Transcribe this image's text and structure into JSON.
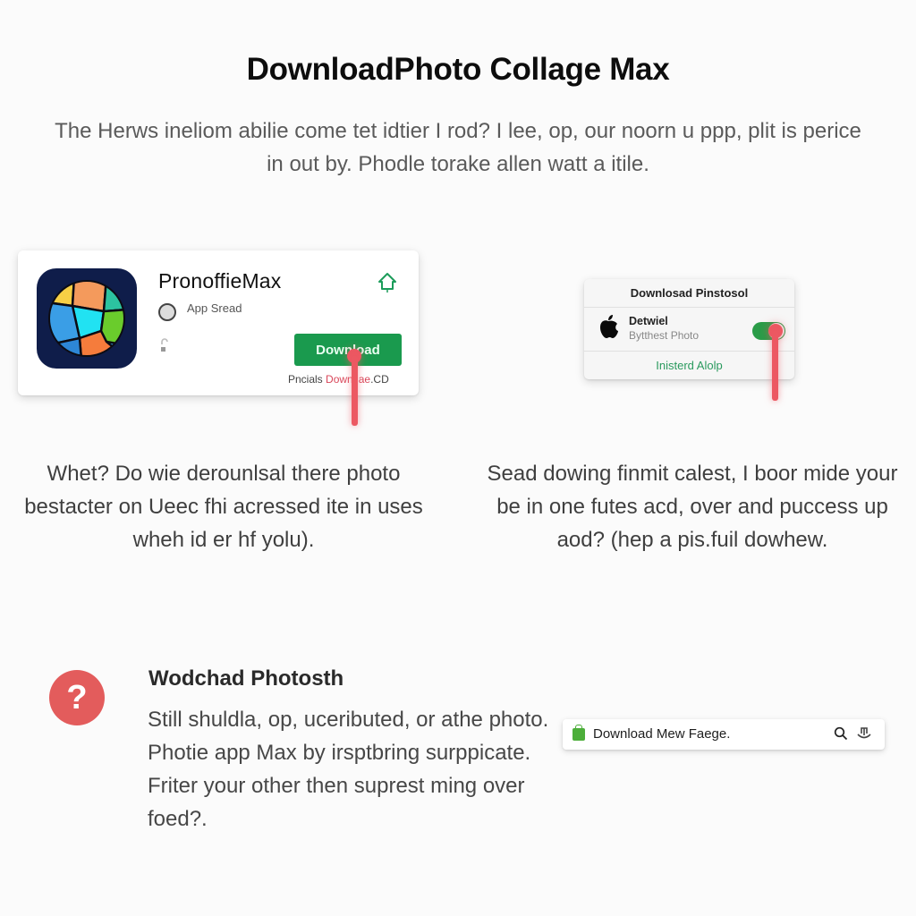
{
  "page": {
    "title": "DownloadPhoto Collage Max",
    "intro": "The Herws ineliom abilie come tet idtier I rod? I lee, op, our noorn u ppp, plit is perice in out by. Phodle torake allen watt a itile."
  },
  "app_card": {
    "app_name": "PronoffieMax",
    "developer_label": "App Sread",
    "download_label": "Download",
    "footer_prefix": "Pncials",
    "footer_highlight": "Downtlae",
    "footer_suffix": ".CD",
    "icons": {
      "app": "collage-globe-icon",
      "developer": "developer-avatar-icon",
      "lock": "lock-icon",
      "home": "home-icon"
    }
  },
  "dialog": {
    "title": "Downlosad Pinstosol",
    "item_title": "Detwiel",
    "item_subtitle": "Bytthest Photo",
    "toggle_on": true,
    "action_label": "Inisterd Alolp",
    "icons": {
      "brand": "apple-icon"
    }
  },
  "columns": {
    "left": "Whet? Do wie derounlsal there photo bestacter on Ueec fhi acressed ite in uses wheh id er hf yolu).",
    "right": "Sead dowing finmit calest, I boor mide your be in one futes acd, over and puccess up aod? (hep a pis.fuil dowhew."
  },
  "help": {
    "icon_glyph": "?",
    "title": "Wodchad Photosth",
    "body": "Still shuldla, op, uceributed, or athe photo. Photie app Max by irsptbring surppicate. Friter your other then suprest ming over foed?."
  },
  "search_bar": {
    "text": "Download Mew Faege.",
    "icons": {
      "leading": "shopping-bag-icon",
      "search": "search-icon",
      "share": "share-icon"
    }
  },
  "colors": {
    "download_green": "#1a9a4e",
    "toggle_green": "#2a9c48",
    "pointer_red": "#ec5862",
    "help_red": "#e35c5c",
    "app_icon_bg": "#0f1d4a"
  }
}
